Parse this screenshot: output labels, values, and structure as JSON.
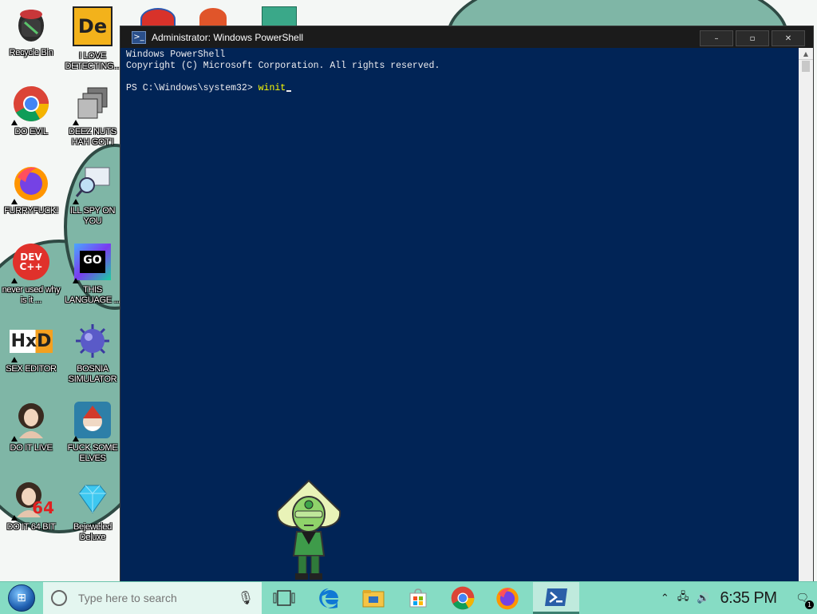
{
  "desktop": {
    "icons": [
      {
        "label": "Recycle Bin",
        "icon": "recycle-bin-icon"
      },
      {
        "label": "I LOVE DETECTING...",
        "icon": "de-app-icon"
      },
      {
        "label": "DO EVIL",
        "icon": "chrome-icon"
      },
      {
        "label": "DEEZ NUTS HAH GOT'I",
        "icon": "window-stack-icon"
      },
      {
        "label": "FURRYFUCK!",
        "icon": "firefox-icon"
      },
      {
        "label": "ILL SPY ON YOU",
        "icon": "spy-magnifier-icon"
      },
      {
        "label": "never used why is it ...",
        "icon": "devcpp-icon",
        "icon_text": "DEV C++"
      },
      {
        "label": "THIS LANGUAGE ...",
        "icon": "goland-icon",
        "icon_text": "GO"
      },
      {
        "label": "SEX EDITOR",
        "icon": "hxd-icon",
        "icon_text": "HxD"
      },
      {
        "label": "BOSNIA SIMULATOR",
        "icon": "mine-ball-icon"
      },
      {
        "label": "DO IT LIVE",
        "icon": "portrait-icon"
      },
      {
        "label": "FUCK SOME ELVES",
        "icon": "elf-game-icon"
      },
      {
        "label": "DO IT 64 BIT",
        "icon": "portrait-64-icon",
        "icon_text": "64"
      },
      {
        "label": "Bejeweled Deluxe",
        "icon": "diamond-icon"
      }
    ]
  },
  "window": {
    "title": "Administrator: Windows PowerShell",
    "icon": "powershell-icon",
    "buttons": {
      "minimize": "–",
      "maximize": "▫",
      "close": "✕"
    }
  },
  "console": {
    "line1": "Windows PowerShell",
    "line2": "Copyright (C) Microsoft Corporation. All rights reserved.",
    "prompt": "PS C:\\Windows\\system32> ",
    "command": "winit"
  },
  "taskbar": {
    "search_placeholder": "Type here to search",
    "pinned": [
      "task-view-icon",
      "edge-icon",
      "file-explorer-icon",
      "store-icon",
      "chrome-icon",
      "firefox-icon",
      "powershell-icon"
    ],
    "clock": "6:35 PM",
    "notification_count": "1"
  },
  "colors": {
    "console_bg": "#012456",
    "command_text": "#ffff00",
    "taskbar_bg": "#86dcc4"
  }
}
